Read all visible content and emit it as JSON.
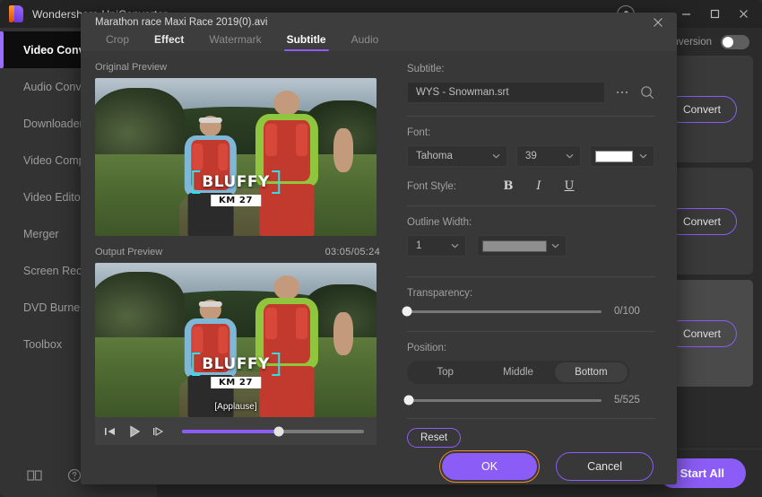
{
  "app": {
    "title": "Wondershare UniConverter",
    "window_controls": {
      "account": "account-avatar",
      "menu": "menu-icon",
      "minimize": "minimize-icon",
      "maximize": "maximize-icon",
      "close": "close-icon"
    }
  },
  "sidebar": {
    "items": [
      {
        "label": "Video Converter",
        "active": true
      },
      {
        "label": "Audio Converter",
        "active": false
      },
      {
        "label": "Downloader",
        "active": false
      },
      {
        "label": "Video Compressor",
        "active": false
      },
      {
        "label": "Video Editor",
        "active": false
      },
      {
        "label": "Merger",
        "active": false
      },
      {
        "label": "Screen Recorder",
        "active": false
      },
      {
        "label": "DVD Burner",
        "active": false
      },
      {
        "label": "Toolbox",
        "active": false
      }
    ],
    "footer_icons": [
      "book-icon",
      "help-icon"
    ]
  },
  "main": {
    "conversion_label": "Conversion",
    "conversion_toggle": "off",
    "tasks": [
      {
        "convert_label": "Convert"
      },
      {
        "convert_label": "Convert"
      },
      {
        "convert_label": "Convert"
      }
    ],
    "start_all_label": "Start All"
  },
  "dialog": {
    "title": "Marathon race  Maxi Race 2019(0).avi",
    "close_icon": "close-icon",
    "tabs": [
      {
        "label": "Crop",
        "state": "normal"
      },
      {
        "label": "Effect",
        "state": "hover"
      },
      {
        "label": "Watermark",
        "state": "normal"
      },
      {
        "label": "Subtitle",
        "state": "active"
      },
      {
        "label": "Audio",
        "state": "normal"
      }
    ],
    "preview": {
      "original_label": "Original Preview",
      "output_label": "Output Preview",
      "timestamp": "03:05/05:24",
      "overlay_title": "BLUFFY",
      "overlay_km": "KM 27",
      "output_caption": "[Applause]",
      "player": {
        "prev_frame_icon": "previous-frame-icon",
        "play_icon": "play-icon",
        "next_frame_icon": "next-frame-icon",
        "progress_percent": 53
      }
    },
    "settings": {
      "subtitle_label": "Subtitle:",
      "subtitle_file": "WYS - Snowman.srt",
      "browse_icon": "ellipsis-icon",
      "search_icon": "search-icon",
      "font_label": "Font:",
      "font_family": "Tahoma",
      "font_size": "39",
      "font_color": "#FFFFFF",
      "font_style_label": "Font Style:",
      "style_bold": "B",
      "style_italic": "I",
      "style_underline": "U",
      "outline_label": "Outline Width:",
      "outline_width": "1",
      "outline_color": "#8F8F8F",
      "transparency_label": "Transparency:",
      "transparency_value": "0/100",
      "transparency_percent": 0,
      "position_label": "Position:",
      "position_options": [
        {
          "label": "Top",
          "selected": false
        },
        {
          "label": "Middle",
          "selected": false
        },
        {
          "label": "Bottom",
          "selected": true
        }
      ],
      "position_value": "5/525",
      "position_percent": 1,
      "reset_label": "Reset"
    },
    "footer": {
      "ok_label": "OK",
      "cancel_label": "Cancel",
      "focus_ring_color": "#F08A26"
    }
  },
  "colors": {
    "accent_purple": "#8B5CF6",
    "focus_orange": "#F08A26",
    "subtitle_cyan": "#2FE0E8"
  }
}
